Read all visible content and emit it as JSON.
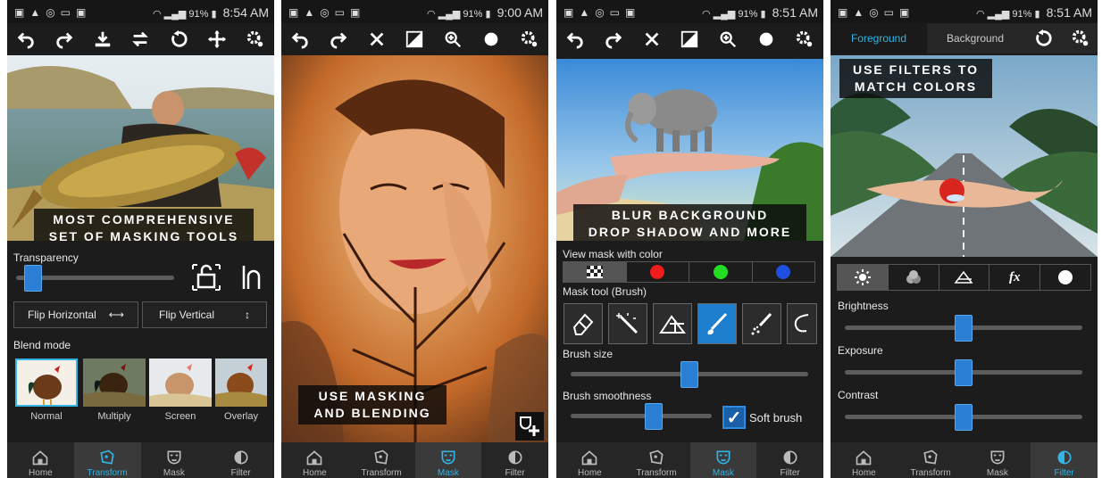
{
  "status": [
    {
      "signal": "91%",
      "time": "8:54 AM"
    },
    {
      "signal": "91%",
      "time": "9:00 AM"
    },
    {
      "signal": "91%",
      "time": "8:51 AM"
    },
    {
      "signal": "91%",
      "time": "8:51 AM"
    }
  ],
  "nav": {
    "home": "Home",
    "transform": "Transform",
    "mask": "Mask",
    "filter": "Filter"
  },
  "screen1": {
    "caption_line1": "MOST COMPREHENSIVE",
    "caption_line2": "SET OF MASKING TOOLS",
    "transparency_label": "Transparency",
    "transparency_value": 0.06,
    "flip_horizontal": "Flip Horizontal",
    "flip_vertical": "Flip Vertical",
    "blend_mode_label": "Blend mode",
    "blend_modes": [
      "Normal",
      "Multiply",
      "Screen",
      "Overlay"
    ]
  },
  "screen2": {
    "caption_line1": "USE MASKING",
    "caption_line2": "AND BLENDING"
  },
  "screen3": {
    "caption_line1": "BLUR BACKGROUND",
    "caption_line2": "DROP SHADOW AND MORE",
    "view_mask_label": "View mask with color",
    "mask_colors": [
      "#ee1c1c",
      "#22dd22",
      "#1f4fe0"
    ],
    "mask_tool_label": "Mask tool (Brush)",
    "brush_size_label": "Brush size",
    "brush_size_value": 0.5,
    "brush_smoothness_label": "Brush smoothness",
    "brush_smoothness_value": 0.6,
    "soft_brush_label": "Soft brush",
    "soft_brush_checked": true
  },
  "screen4": {
    "tab_foreground": "Foreground",
    "tab_background": "Background",
    "caption_line1": "USE FILTERS TO",
    "caption_line2": "MATCH COLORS",
    "filter_fx": "fx",
    "brightness_label": "Brightness",
    "brightness_value": 0.5,
    "exposure_label": "Exposure",
    "exposure_value": 0.5,
    "contrast_label": "Contrast",
    "contrast_value": 0.5
  },
  "colors": {
    "accent": "#33b5e5",
    "slider": "#2a7fd4"
  }
}
